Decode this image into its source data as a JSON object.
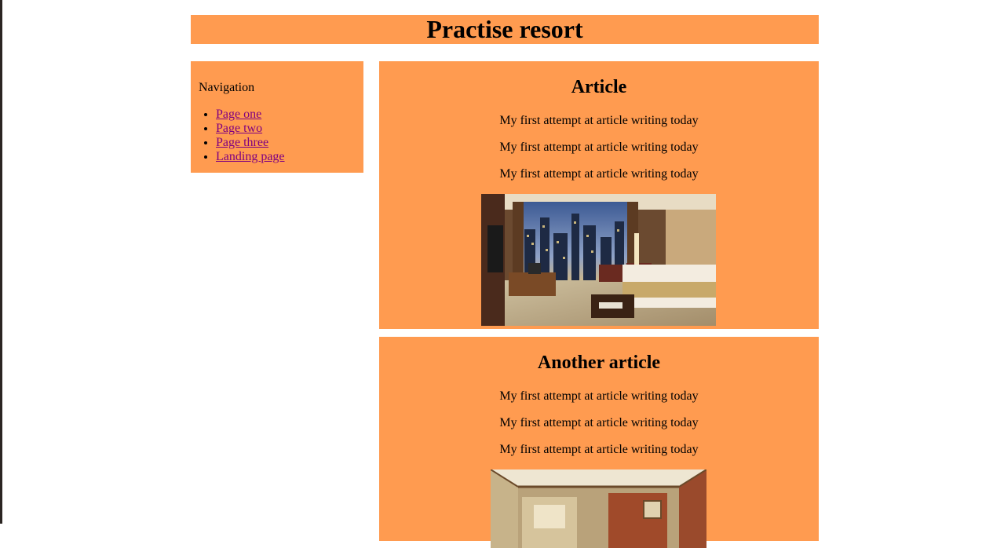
{
  "header": {
    "title": "Practise resort"
  },
  "sidebar": {
    "heading": "Navigation",
    "links": [
      {
        "label": "Page one"
      },
      {
        "label": "Page two"
      },
      {
        "label": "Page three"
      },
      {
        "label": "Landing page"
      }
    ]
  },
  "articles": [
    {
      "title": "Article",
      "lines": [
        "My first attempt at article writing today",
        "My first attempt at article writing today",
        "My first attempt at article writing today"
      ],
      "image": "hotel-room-photo"
    },
    {
      "title": "Another article",
      "lines": [
        "My first attempt at article writing today",
        "My first attempt at article writing today",
        "My first attempt at article writing today"
      ],
      "image": "hotel-suite-photo"
    }
  ],
  "colors": {
    "panel_background": "#ff9b50",
    "link_color": "#800080",
    "page_background": "#ffffff"
  }
}
